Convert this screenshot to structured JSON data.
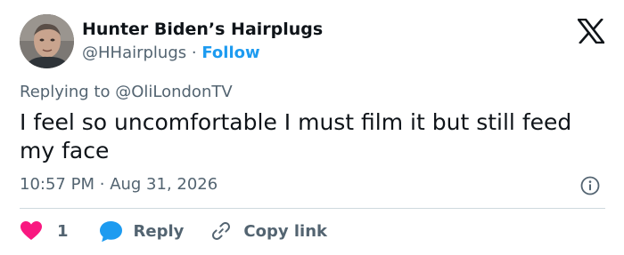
{
  "author": {
    "display_name": "Hunter Biden’s Hairplugs",
    "handle": "@HHairplugs",
    "separator": "·",
    "follow_label": "Follow"
  },
  "reply_context": {
    "prefix": "Replying to ",
    "mention": "@OliLondonTV"
  },
  "tweet": {
    "text": "I feel so uncomfortable I must film it but still feed my face",
    "time": "10:57 PM",
    "separator": "·",
    "date": "Aug 31, 2026"
  },
  "actions": {
    "like_count": "1",
    "reply_label": "Reply",
    "copy_link_label": "Copy link"
  },
  "icons": {
    "brand": "x-logo-icon",
    "info": "info-icon",
    "like": "heart-icon",
    "reply": "speech-bubble-icon",
    "copy_link": "link-icon"
  },
  "colors": {
    "like": "#f91880",
    "reply": "#1d9bf0",
    "link_accent": "#1d9bf0",
    "secondary_text": "#536471"
  }
}
